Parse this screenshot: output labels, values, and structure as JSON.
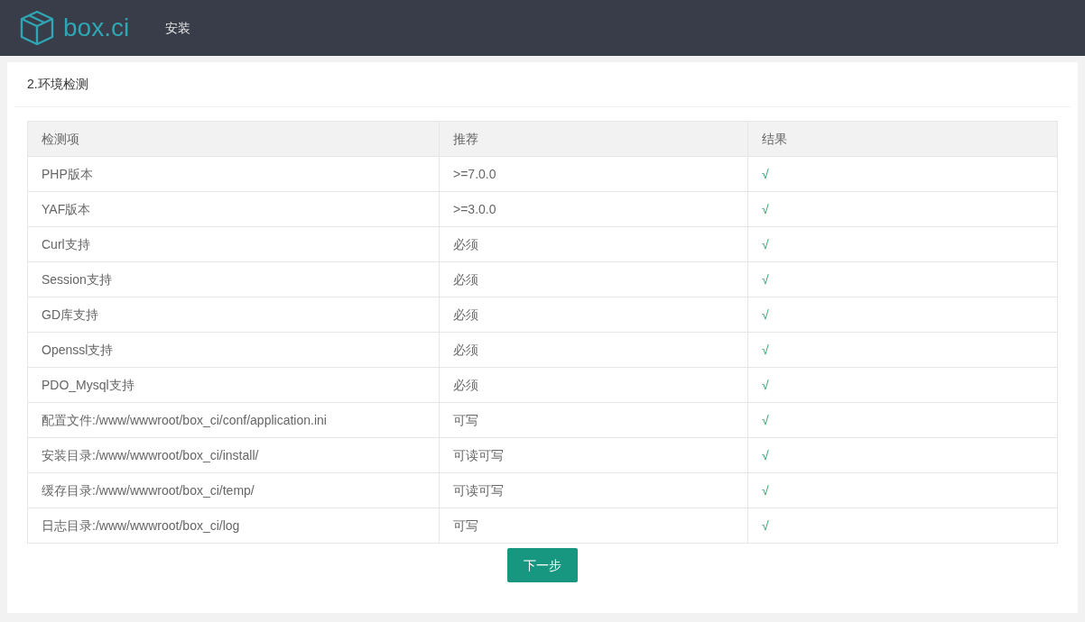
{
  "header": {
    "logo_text": "box.ci",
    "nav": [
      "安装"
    ]
  },
  "card": {
    "title": "2.环境检测"
  },
  "table": {
    "columns": [
      "检测项",
      "推荐",
      "结果"
    ],
    "rows": [
      {
        "item": "PHP版本",
        "recommended": ">=7.0.0",
        "result": "√",
        "ok": true
      },
      {
        "item": "YAF版本",
        "recommended": ">=3.0.0",
        "result": "√",
        "ok": true
      },
      {
        "item": "Curl支持",
        "recommended": "必须",
        "result": "√",
        "ok": true
      },
      {
        "item": "Session支持",
        "recommended": "必须",
        "result": "√",
        "ok": true
      },
      {
        "item": "GD库支持",
        "recommended": "必须",
        "result": "√",
        "ok": true
      },
      {
        "item": "Openssl支持",
        "recommended": "必须",
        "result": "√",
        "ok": true
      },
      {
        "item": "PDO_Mysql支持",
        "recommended": "必须",
        "result": "√",
        "ok": true
      },
      {
        "item": "配置文件:/www/wwwroot/box_ci/conf/application.ini",
        "recommended": "可写",
        "result": "√",
        "ok": true
      },
      {
        "item": "安装目录:/www/wwwroot/box_ci/install/",
        "recommended": "可读可写",
        "result": "√",
        "ok": true
      },
      {
        "item": "缓存目录:/www/wwwroot/box_ci/temp/",
        "recommended": "可读可写",
        "result": "√",
        "ok": true
      },
      {
        "item": "日志目录:/www/wwwroot/box_ci/log",
        "recommended": "可写",
        "result": "√",
        "ok": true
      }
    ]
  },
  "next_button": "下一步"
}
